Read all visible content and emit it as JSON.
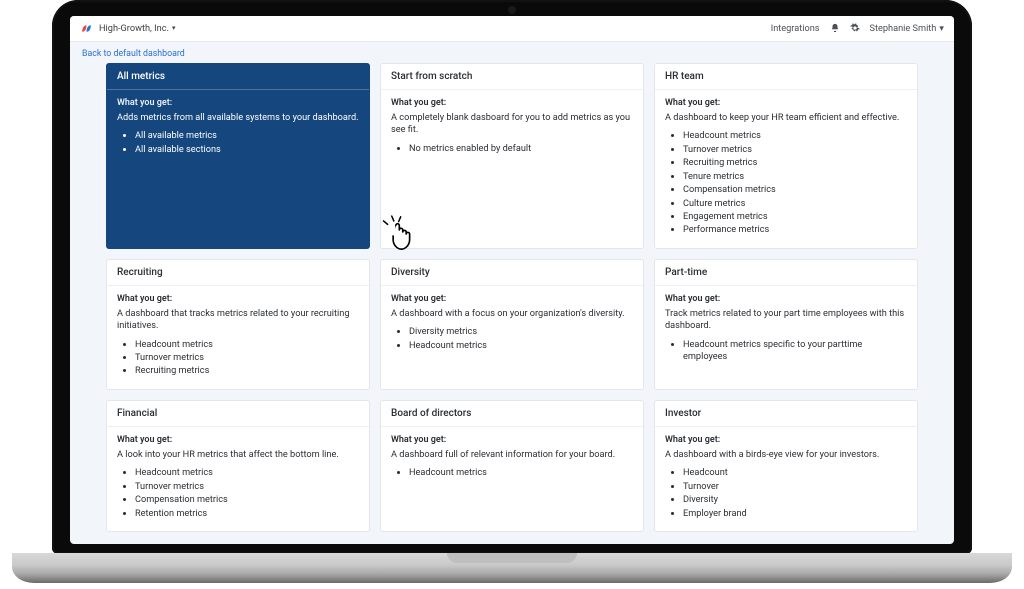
{
  "topbar": {
    "org_name": "High-Growth, Inc.",
    "integrations_label": "Integrations",
    "user_name": "Stephanie Smith"
  },
  "backlink_label": "Back to default dashboard",
  "what_label": "What you get:",
  "cards": [
    {
      "title": "All metrics",
      "desc": "Adds metrics from all available systems to your dashboard.",
      "items": [
        "All available metrics",
        "All available sections"
      ]
    },
    {
      "title": "Start from scratch",
      "desc": "A completely blank dasboard for you to add metrics as you see fit.",
      "items": [
        "No metrics enabled by default"
      ]
    },
    {
      "title": "HR team",
      "desc": "A dashboard to keep your HR team efficient and effective.",
      "items": [
        "Headcount metrics",
        "Turnover metrics",
        "Recruiting metrics",
        "Tenure metrics",
        "Compensation metrics",
        "Culture metrics",
        "Engagement metrics",
        "Performance metrics"
      ]
    },
    {
      "title": "Recruiting",
      "desc": "A dashboard that tracks metrics related to your recruiting initiatives.",
      "items": [
        "Headcount metrics",
        "Turnover metrics",
        "Recruiting metrics"
      ]
    },
    {
      "title": "Diversity",
      "desc": "A dashboard with a focus on your organization's diversity.",
      "items": [
        "Diversity metrics",
        "Headcount metrics"
      ]
    },
    {
      "title": "Part-time",
      "desc": "Track metrics related to your part time employees with this dashboard.",
      "items": [
        "Headcount metrics specific to your parttime employees"
      ]
    },
    {
      "title": "Financial",
      "desc": "A look into your HR metrics that affect the bottom line.",
      "items": [
        "Headcount metrics",
        "Turnover metrics",
        "Compensation metrics",
        "Retention metrics"
      ]
    },
    {
      "title": "Board of directors",
      "desc": "A dashboard full of relevant information for your board.",
      "items": [
        "Headcount metrics"
      ]
    },
    {
      "title": "Investor",
      "desc": "A dashboard with a birds-eye view for your investors.",
      "items": [
        "Headcount",
        "Turnover",
        "Diversity",
        "Employer brand"
      ]
    }
  ]
}
